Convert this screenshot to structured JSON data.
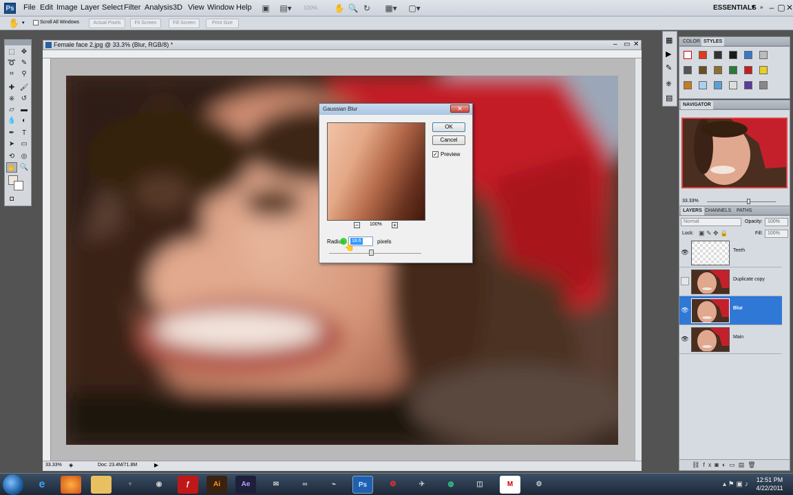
{
  "app": {
    "logo": "Ps"
  },
  "menu": [
    "File",
    "Edit",
    "Image",
    "Layer",
    "Select",
    "Filter",
    "Analysis",
    "3D",
    "View",
    "Window",
    "Help"
  ],
  "menubar": {
    "zoom_value": "100%",
    "workspace": "ESSENTIALS"
  },
  "options": {
    "scroll_all_windows": "Scroll All Windows",
    "buttons": [
      "Actual Pixels",
      "Fit Screen",
      "Fill Screen",
      "Print Size"
    ]
  },
  "document": {
    "title": "Female face 2.jpg @ 33.3% (Blur, RGB/8) *",
    "zoom": "33.33%",
    "doc_size": "Doc: 23.4M/71.8M"
  },
  "panels": {
    "color_tabs": [
      "COLOR",
      "STYLES"
    ],
    "navigator_tab": "NAVIGATOR",
    "nav_zoom": "33.33%",
    "layer_tabs": [
      "LAYERS",
      "CHANNELS",
      "PATHS"
    ],
    "blend_mode": "Normal",
    "opacity_label": "Opacity:",
    "opacity_value": "100%",
    "lock_label": "Lock:",
    "fill_label": "Fill:",
    "fill_value": "100%",
    "layers": [
      {
        "name": "Teeth",
        "visible": true,
        "selected": false
      },
      {
        "name": "Duplicate copy",
        "visible": false,
        "selected": false
      },
      {
        "name": "Blur",
        "visible": true,
        "selected": true
      },
      {
        "name": "Main",
        "visible": true,
        "selected": false
      }
    ]
  },
  "dialog": {
    "title": "Gaussian Blur",
    "ok": "OK",
    "cancel": "Cancel",
    "preview_label": "Preview",
    "preview_checked": true,
    "zoom": "100%",
    "radius_label": "Radius:",
    "radius_value": "18.6",
    "unit": "pixels"
  },
  "taskbar": {
    "apps": [
      "IE",
      "Firefox",
      "Explorer",
      "Quake",
      "Flash",
      "Illustrator",
      "After Effects",
      "Messenger",
      "Ident",
      "Remote",
      "Photoshop",
      "Acrobat",
      "Folder",
      "Dreamweaver",
      "Outlook",
      "Gmail",
      "Tool"
    ],
    "labels": {
      "illustrator": "Ai",
      "after_effects": "Ae",
      "photoshop": "Ps",
      "gmail": "M"
    },
    "time": "12:51 PM",
    "date": "4/22/2011"
  },
  "colors": {
    "accent": "#2f78d6",
    "photo_hat": "#c8202a",
    "photo_hair": "#3b2418"
  }
}
